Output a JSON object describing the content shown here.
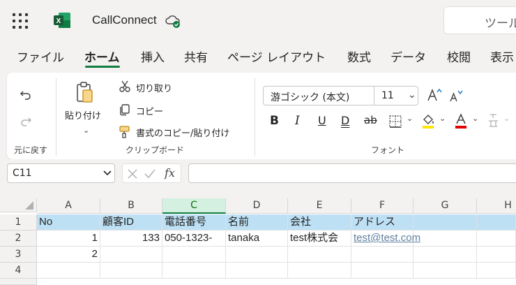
{
  "app": {
    "doc_title": "CallConnect",
    "search_placeholder": "ツール"
  },
  "tabs": [
    {
      "label": "ファイル"
    },
    {
      "label": "ホーム"
    },
    {
      "label": "挿入"
    },
    {
      "label": "共有"
    },
    {
      "label": "ページ レイアウト"
    },
    {
      "label": "数式"
    },
    {
      "label": "データ"
    },
    {
      "label": "校閲"
    },
    {
      "label": "表示"
    }
  ],
  "ribbon": {
    "undo_group_label": "元に戻す",
    "paste_label": "貼り付け",
    "cut_label": "切り取り",
    "copy_label": "コピー",
    "format_painter_label": "書式のコピー/貼り付け",
    "clipboard_group_label": "クリップボード",
    "font_name": "游ゴシック (本文)",
    "font_size": "11",
    "font_group_label": "フォント",
    "font_color": "#e00000",
    "fill_color": "#ffe600"
  },
  "formula_bar": {
    "cell_ref": "C11",
    "formula": "",
    "fx_label": "fx"
  },
  "sheet": {
    "columns": [
      "A",
      "B",
      "C",
      "D",
      "E",
      "F",
      "G",
      "H"
    ],
    "selected_column": "C",
    "rows": [
      {
        "num": "1",
        "cells": [
          "No",
          "顧客ID",
          "電話番号",
          "名前",
          "会社",
          "アドレス",
          "",
          ""
        ]
      },
      {
        "num": "2",
        "cells": [
          "1",
          "133",
          "050-1323-",
          "tanaka",
          "test株式会",
          "test@test.com",
          "",
          ""
        ]
      },
      {
        "num": "3",
        "cells": [
          "2",
          "",
          "",
          "",
          "",
          "",
          "",
          ""
        ]
      },
      {
        "num": "4",
        "cells": [
          "",
          "",
          "",
          "",
          "",
          "",
          "",
          ""
        ]
      }
    ]
  }
}
